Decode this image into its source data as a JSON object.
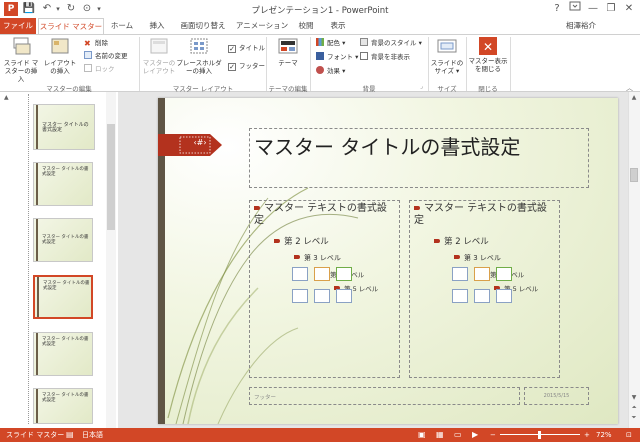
{
  "window": {
    "app_icon_letter": "P",
    "title": "プレゼンテーション1 - PowerPoint",
    "help": "?",
    "minimize": "—",
    "restore": "❐",
    "close": "✕"
  },
  "qat": {
    "save": "💾",
    "undo": "↶",
    "redo": "↻",
    "touch": "⊙",
    "more": "▾"
  },
  "tabs": [
    {
      "label": "ファイル"
    },
    {
      "label": "スライド マスター"
    },
    {
      "label": "ホーム"
    },
    {
      "label": "挿入"
    },
    {
      "label": "画面切り替え"
    },
    {
      "label": "アニメーション"
    },
    {
      "label": "校閲"
    },
    {
      "label": "表示"
    }
  ],
  "user": {
    "name": "相澤裕介",
    "collapse": "︿"
  },
  "ribbon": {
    "edit_master": {
      "label": "マスターの編集",
      "insert_slide_master": "スライド マスターの挿入",
      "insert_layout": "レイアウトの挿入",
      "delete": "削除",
      "rename": "名前の変更",
      "preserve": "ロック"
    },
    "master_layout": {
      "label": "マスター レイアウト",
      "master_layout_btn": "マスターのレイアウト",
      "insert_placeholder": "プレースホルダーの挿入",
      "title_cb": "タイトル",
      "footer_cb": "フッター"
    },
    "edit_theme": {
      "label": "テーマの編集",
      "themes": "テーマ"
    },
    "background": {
      "label": "背景",
      "colors": "配色",
      "fonts": "フォント",
      "effects": "効果",
      "bg_styles": "背景のスタイル",
      "hide_bg": "背景を非表示"
    },
    "size": {
      "label": "サイズ",
      "slide_size": "スライドのサイズ"
    },
    "close": {
      "label": "閉じる",
      "close_master": "マスター表示を閉じる"
    }
  },
  "thumbnails": [
    {
      "text": "マスター タイトルの書式設定"
    },
    {
      "text": "マスター タイトルの書式設定"
    },
    {
      "text": "マスター タイトルの書式設定"
    },
    {
      "text": "マスター タイトルの書式設定"
    },
    {
      "text": "マスター タイトルの書式設定"
    },
    {
      "text": "マスター タイトルの書式設定"
    }
  ],
  "slide": {
    "tag": "‹#›",
    "title": "マスター タイトルの書式設定",
    "left": {
      "l1": "マスター テキストの書式設定",
      "l2": "第 2 レベル",
      "l3": "第 3 レベル",
      "l4": "第 4 レベル",
      "l5": "第 5 レベル"
    },
    "right": {
      "l1": "マスター テキストの書式設定",
      "l2": "第 2 レベル",
      "l3": "第 3 レベル",
      "l4": "第 4 レベル",
      "l5": "第 5 レベル"
    },
    "footer": "フッター",
    "date": "2015/5/15"
  },
  "status": {
    "view": "スライド マスター",
    "language": "日本語",
    "zoom": "72%",
    "zoom_minus": "−",
    "zoom_plus": "+",
    "fit": "⊡"
  },
  "colors": {
    "accent": "#d24726",
    "slide_bar": "#5f5545",
    "bullet": "#b3321e"
  }
}
